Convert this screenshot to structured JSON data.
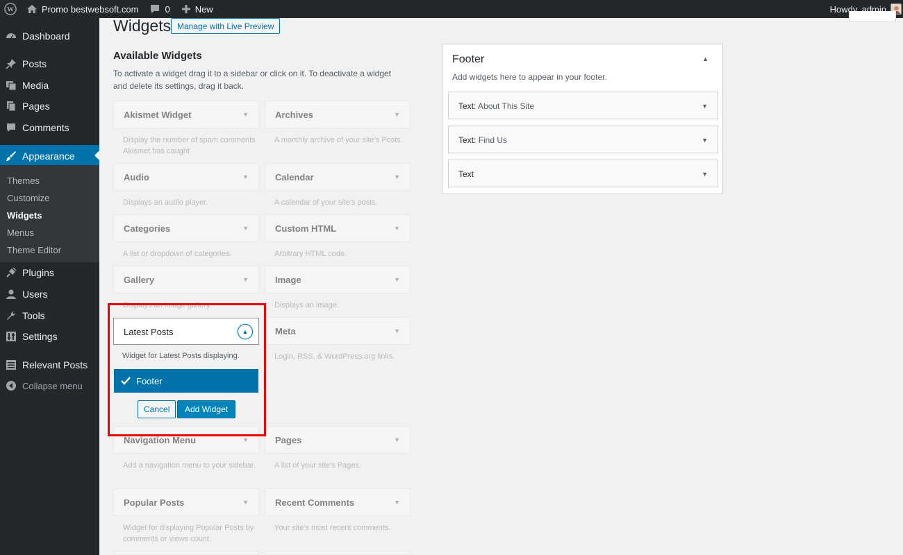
{
  "admin_bar": {
    "site_name": "Promo bestwebsoft.com",
    "comments_count": "0",
    "new_label": "New",
    "howdy": "Howdy, admin"
  },
  "sidebar": {
    "items": [
      {
        "label": "Dashboard",
        "icon": "dashboard-icon"
      },
      {
        "label": "Posts",
        "icon": "pin-icon"
      },
      {
        "label": "Media",
        "icon": "media-icon"
      },
      {
        "label": "Pages",
        "icon": "pages-icon"
      },
      {
        "label": "Comments",
        "icon": "comment-icon"
      },
      {
        "label": "Appearance",
        "icon": "brush-icon",
        "current": true
      },
      {
        "label": "Plugins",
        "icon": "plug-icon"
      },
      {
        "label": "Users",
        "icon": "user-icon"
      },
      {
        "label": "Tools",
        "icon": "wrench-icon"
      },
      {
        "label": "Settings",
        "icon": "settings-icon"
      },
      {
        "label": "Relevant Posts",
        "icon": "list-icon"
      }
    ],
    "submenu": [
      {
        "label": "Themes"
      },
      {
        "label": "Customize"
      },
      {
        "label": "Widgets",
        "current": true
      },
      {
        "label": "Menus"
      },
      {
        "label": "Theme Editor"
      }
    ],
    "collapse": "Collapse menu"
  },
  "page": {
    "title": "Widgets",
    "live_preview": "Manage with Live Preview"
  },
  "available": {
    "title": "Available Widgets",
    "description": "To activate a widget drag it to a sidebar or click on it. To deactivate a widget and delete its settings, drag it back.",
    "widgets": [
      {
        "title": "Akismet Widget",
        "desc": "Display the number of spam comments Akismet has caught"
      },
      {
        "title": "Archives",
        "desc": "A monthly archive of your site's Posts."
      },
      {
        "title": "Audio",
        "desc": "Displays an audio player."
      },
      {
        "title": "Calendar",
        "desc": "A calendar of your site's posts."
      },
      {
        "title": "Categories",
        "desc": "A list or dropdown of categories."
      },
      {
        "title": "Custom HTML",
        "desc": "Arbitrary HTML code."
      },
      {
        "title": "Gallery",
        "desc": "Displays an image gallery."
      },
      {
        "title": "Image",
        "desc": "Displays an image."
      },
      {
        "title": "Meta",
        "desc": "Login, RSS, & WordPress.org links."
      },
      {
        "title": "Navigation Menu",
        "desc": "Add a navigation menu to your sidebar."
      },
      {
        "title": "Pages",
        "desc": "A list of your site's Pages."
      },
      {
        "title": "Popular Posts",
        "desc": "Widget for displaying Popular Posts by comments or views count."
      },
      {
        "title": "Recent Comments",
        "desc": "Your site's most recent comments."
      }
    ]
  },
  "expanded": {
    "title": "Latest Posts",
    "description": "Widget for Latest Posts displaying.",
    "choice": "Footer",
    "cancel": "Cancel",
    "add": "Add Widget"
  },
  "footer_sidebar": {
    "title": "Footer",
    "description": "Add widgets here to appear in your footer.",
    "widgets": [
      {
        "type": "Text:",
        "name": "About This Site"
      },
      {
        "type": "Text:",
        "name": "Find Us"
      },
      {
        "type": "Text",
        "name": ""
      }
    ]
  },
  "colors": {
    "admin_bg": "#23282d",
    "accent": "#0073aa",
    "highlight": "#ee0000"
  }
}
